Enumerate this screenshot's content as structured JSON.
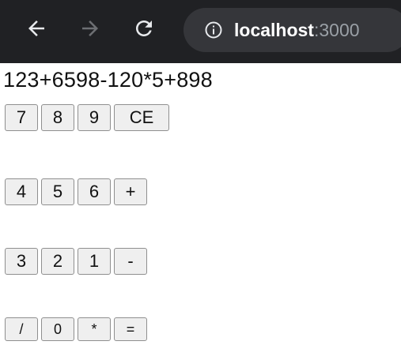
{
  "browser": {
    "url_host": "localhost",
    "url_port": ":3000"
  },
  "calculator": {
    "display": "123+6598-120*5+898",
    "rows": [
      [
        "7",
        "8",
        "9",
        "CE"
      ],
      [
        "4",
        "5",
        "6",
        "+"
      ],
      [
        "3",
        "2",
        "1",
        "-"
      ],
      [
        "/",
        "0",
        "*",
        "="
      ]
    ]
  },
  "icons": {
    "back": "back-arrow-icon",
    "forward": "forward-arrow-icon",
    "reload": "reload-icon",
    "info": "info-icon"
  }
}
